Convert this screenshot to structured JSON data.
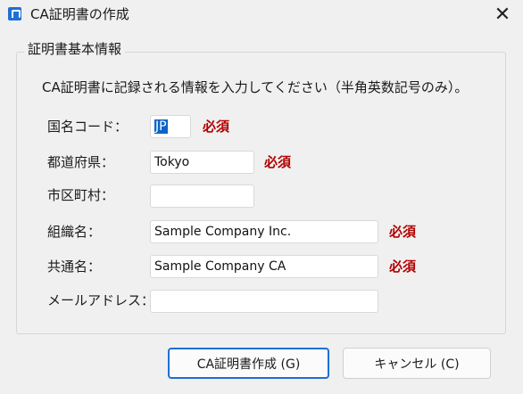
{
  "window": {
    "title": "CA証明書の作成",
    "close_glyph": "✕"
  },
  "group": {
    "title": "証明書基本情報",
    "description": "CA証明書に記録される情報を入力してください（半角英数記号のみ）。"
  },
  "fields": {
    "country": {
      "label": "国名コード：",
      "value": "JP",
      "required": "必須"
    },
    "state": {
      "label": "都道府県：",
      "value": "Tokyo",
      "required": "必須"
    },
    "city": {
      "label": "市区町村：",
      "value": ""
    },
    "organization": {
      "label": "組織名：",
      "value": "Sample Company Inc.",
      "required": "必須"
    },
    "common_name": {
      "label": "共通名：",
      "value": "Sample Company CA",
      "required": "必須"
    },
    "email": {
      "label": "メールアドレス：",
      "value": ""
    }
  },
  "buttons": {
    "create": "CA証明書作成 (G)",
    "cancel": "キャンセル (C)"
  },
  "colors": {
    "accent": "#1f6fd6",
    "required_text": "#b10000",
    "selection": "#0a64c8",
    "background": "#f0f0f0"
  }
}
